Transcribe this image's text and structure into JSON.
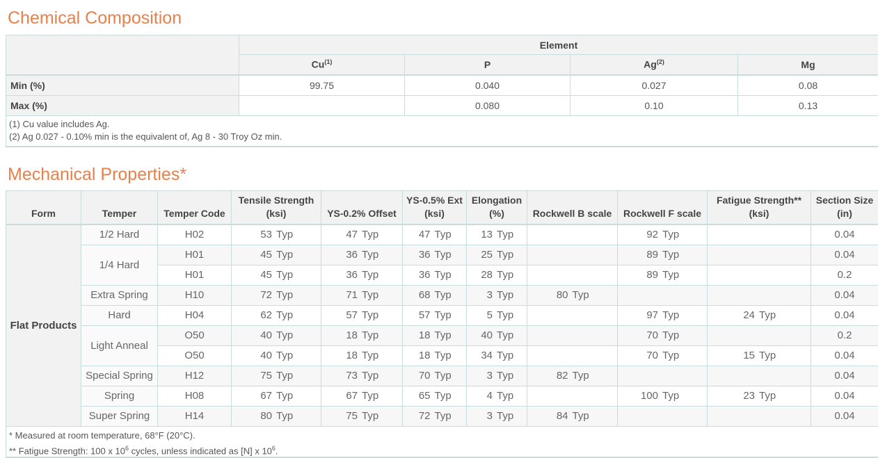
{
  "chem": {
    "title": "Chemical Composition",
    "group_header": "Element",
    "elements": [
      {
        "name": "Cu",
        "note": "(1)"
      },
      {
        "name": "P",
        "note": ""
      },
      {
        "name": "Ag",
        "note": "(2)"
      },
      {
        "name": "Mg",
        "note": ""
      }
    ],
    "rows": [
      {
        "label": "Min (%)",
        "values": [
          "99.75",
          "0.040",
          "0.027",
          "0.08"
        ]
      },
      {
        "label": "Max (%)",
        "values": [
          "",
          "0.080",
          "0.10",
          "0.13"
        ]
      }
    ],
    "notes": [
      "(1) Cu value includes Ag.",
      "(2) Ag 0.027 - 0.10% min is the equivalent of, Ag 8 - 30 Troy Oz min."
    ]
  },
  "mech": {
    "title": "Mechanical Properties*",
    "headers": [
      "Form",
      "Temper",
      "Temper Code",
      "Tensile Strength (ksi)",
      "YS-0.2% Offset",
      "YS-0.5% Ext (ksi)",
      "Elongation (%)",
      "Rockwell B scale",
      "Rockwell F scale",
      "Fatigue Strength** (ksi)",
      "Section Size (in)"
    ],
    "form": "Flat Products",
    "typ": "Typ",
    "rows": [
      {
        "temper": "1/2 Hard",
        "span": 1,
        "code": "H02",
        "tensile": "53",
        "ys02": "47",
        "ys05": "47",
        "elong": "13",
        "rb": "",
        "rf": "92",
        "fatigue": "",
        "size": "0.04"
      },
      {
        "temper": "1/4 Hard",
        "span": 2,
        "code": "H01",
        "tensile": "45",
        "ys02": "36",
        "ys05": "36",
        "elong": "25",
        "rb": "",
        "rf": "89",
        "fatigue": "",
        "size": "0.04"
      },
      {
        "temper": "",
        "span": 0,
        "code": "H01",
        "tensile": "45",
        "ys02": "36",
        "ys05": "36",
        "elong": "28",
        "rb": "",
        "rf": "89",
        "fatigue": "",
        "size": "0.2"
      },
      {
        "temper": "Extra Spring",
        "span": 1,
        "code": "H10",
        "tensile": "72",
        "ys02": "71",
        "ys05": "68",
        "elong": "3",
        "rb": "80",
        "rf": "",
        "fatigue": "",
        "size": "0.04"
      },
      {
        "temper": "Hard",
        "span": 1,
        "code": "H04",
        "tensile": "62",
        "ys02": "57",
        "ys05": "57",
        "elong": "5",
        "rb": "",
        "rf": "97",
        "fatigue": "24",
        "size": "0.04"
      },
      {
        "temper": "Light Anneal",
        "span": 2,
        "code": "O50",
        "tensile": "40",
        "ys02": "18",
        "ys05": "18",
        "elong": "40",
        "rb": "",
        "rf": "70",
        "fatigue": "",
        "size": "0.2"
      },
      {
        "temper": "",
        "span": 0,
        "code": "O50",
        "tensile": "40",
        "ys02": "18",
        "ys05": "18",
        "elong": "34",
        "rb": "",
        "rf": "70",
        "fatigue": "15",
        "size": "0.04"
      },
      {
        "temper": "Special Spring",
        "span": 1,
        "code": "H12",
        "tensile": "75",
        "ys02": "73",
        "ys05": "70",
        "elong": "3",
        "rb": "82",
        "rf": "",
        "fatigue": "",
        "size": "0.04"
      },
      {
        "temper": "Spring",
        "span": 1,
        "code": "H08",
        "tensile": "67",
        "ys02": "67",
        "ys05": "65",
        "elong": "4",
        "rb": "",
        "rf": "100",
        "fatigue": "23",
        "size": "0.04"
      },
      {
        "temper": "Super Spring",
        "span": 1,
        "code": "H14",
        "tensile": "80",
        "ys02": "75",
        "ys05": "72",
        "elong": "3",
        "rb": "84",
        "rf": "",
        "fatigue": "",
        "size": "0.04"
      }
    ],
    "note1": "* Measured at room temperature, 68°F (20°C).",
    "note2_a": "** Fatigue Strength: 100 x 10",
    "note2_exp": "6",
    "note2_b": " cycles, unless indicated as [N] x 10",
    "note2_exp2": "6",
    "note2_c": "."
  }
}
